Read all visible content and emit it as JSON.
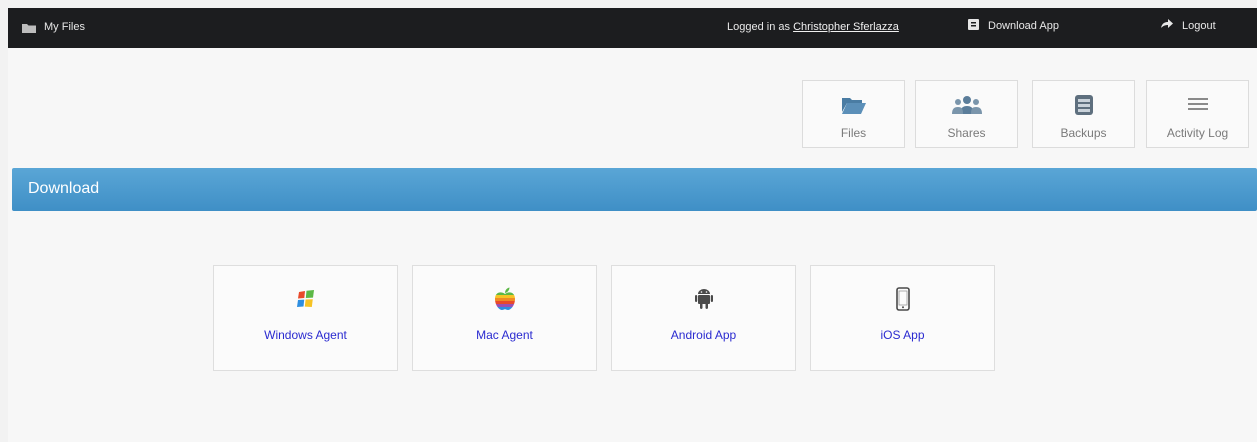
{
  "topbar": {
    "brand_label": "My Files",
    "logged_in_prefix": "Logged in as",
    "user_name": "Christopher Sferlazza",
    "download_app_label": "Download App",
    "logout_label": "Logout"
  },
  "nav": {
    "files_label": "Files",
    "shares_label": "Shares",
    "backups_label": "Backups",
    "activity_log_label": "Activity Log"
  },
  "section_title": "Download",
  "downloads": {
    "windows_label": "Windows Agent",
    "mac_label": "Mac Agent",
    "android_label": "Android App",
    "ios_label": "iOS App"
  },
  "colors": {
    "topbar_bg": "#1c1d1f",
    "header_blue": "#4a99cc",
    "link_blue": "#2a2ad0"
  }
}
